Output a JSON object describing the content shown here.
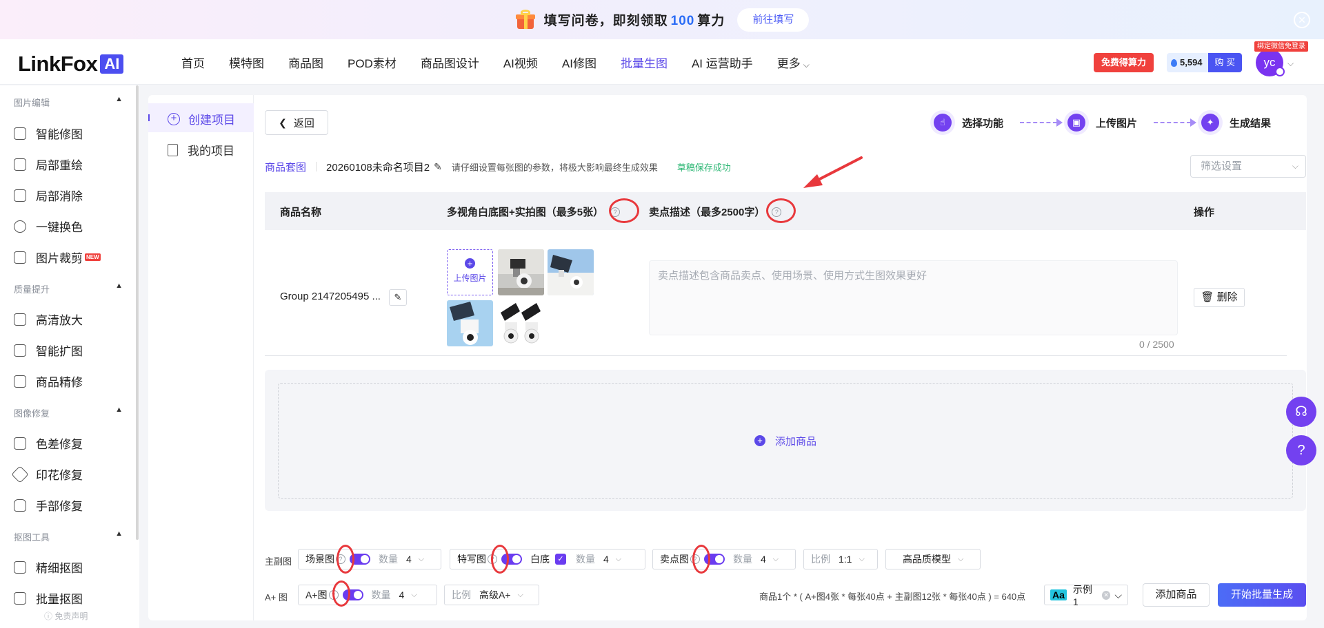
{
  "banner": {
    "text_before": "填写问卷，即刻领取",
    "number": "100",
    "text_after": "算力",
    "cta": "前往填写"
  },
  "logo": {
    "text": "LinkFox",
    "badge": "AI"
  },
  "nav": {
    "items": [
      "首页",
      "模特图",
      "商品图",
      "POD素材",
      "商品图设计",
      "AI视频",
      "AI修图",
      "批量生图",
      "AI 运营助手",
      "更多"
    ],
    "active_index": 7
  },
  "header": {
    "free_btn": "免费得算力",
    "points": "5,594",
    "buy": "购 买",
    "avatar_initials": "yc",
    "bind_tag": "绑定微信免登录"
  },
  "sidebar": {
    "groups": [
      {
        "title": "图片编辑",
        "items": [
          {
            "label": "智能修图",
            "icon": "wand-icon"
          },
          {
            "label": "局部重绘",
            "icon": "brush-icon"
          },
          {
            "label": "局部消除",
            "icon": "eraser-icon"
          },
          {
            "label": "一键换色",
            "icon": "color-swap-icon"
          },
          {
            "label": "图片裁剪",
            "icon": "crop-icon",
            "badge": "NEW"
          }
        ]
      },
      {
        "title": "质量提升",
        "items": [
          {
            "label": "高清放大",
            "icon": "expand-icon"
          },
          {
            "label": "智能扩图",
            "icon": "extend-icon"
          },
          {
            "label": "商品精修",
            "icon": "refine-icon"
          }
        ]
      },
      {
        "title": "图像修复",
        "items": [
          {
            "label": "色差修复",
            "icon": "palette-icon"
          },
          {
            "label": "印花修复",
            "icon": "pattern-icon"
          },
          {
            "label": "手部修复",
            "icon": "hand-icon"
          }
        ]
      },
      {
        "title": "抠图工具",
        "items": [
          {
            "label": "精细抠图",
            "icon": "cutout-icon"
          },
          {
            "label": "批量抠图",
            "icon": "batch-cutout-icon"
          }
        ]
      }
    ],
    "disclaimer": "免责声明"
  },
  "subnav": {
    "items": [
      "创建项目",
      "我的项目"
    ],
    "active_index": 0
  },
  "toolbar": {
    "back": "返回"
  },
  "steps": [
    "选择功能",
    "上传图片",
    "生成结果"
  ],
  "project": {
    "suite": "商品套图",
    "name": "20260108未命名项目2",
    "hint": "请仔细设置每张图的参数，将极大影响最终生成效果",
    "saved": "草稿保存成功",
    "filter_placeholder": "筛选设置"
  },
  "table": {
    "headers": [
      "商品名称",
      "多视角白底图+实拍图（最多5张）",
      "卖点描述（最多2500字）",
      "操作"
    ],
    "rows": [
      {
        "name": "Group 2147205495 ...",
        "upload_label": "上传图片",
        "desc_placeholder": "卖点描述包含商品卖点、使用场景、使用方式生图效果更好",
        "counter": "0 / 2500",
        "delete": "删除"
      }
    ]
  },
  "add_product": "添加商品",
  "config": {
    "main_label": "主副图",
    "aplus_label": "A+ 图",
    "scene": {
      "label": "场景图",
      "qty_label": "数量",
      "qty": "4"
    },
    "closeup": {
      "label": "特写图",
      "white_label": "白底",
      "qty_label": "数量",
      "qty": "4"
    },
    "selling": {
      "label": "卖点图",
      "qty_label": "数量",
      "qty": "4"
    },
    "ratio": {
      "label": "比例",
      "value": "1:1"
    },
    "model": {
      "value": "高品质模型"
    },
    "aplus": {
      "label": "A+图",
      "qty_label": "数量",
      "qty": "4"
    },
    "aplus_ratio": {
      "label": "比例",
      "value": "高级A+"
    },
    "formula": "商品1个 * ( A+图4张 * 每张40点 + 主副图12张 * 每张40点 ) = 640点",
    "example_font": "Aa",
    "example": "示例1",
    "add_btn": "添加商品",
    "start_btn": "开始批量生成"
  },
  "colors": {
    "accent": "#5b48e8",
    "danger": "#e8383c",
    "primary_btn": "#4c6cf6"
  }
}
